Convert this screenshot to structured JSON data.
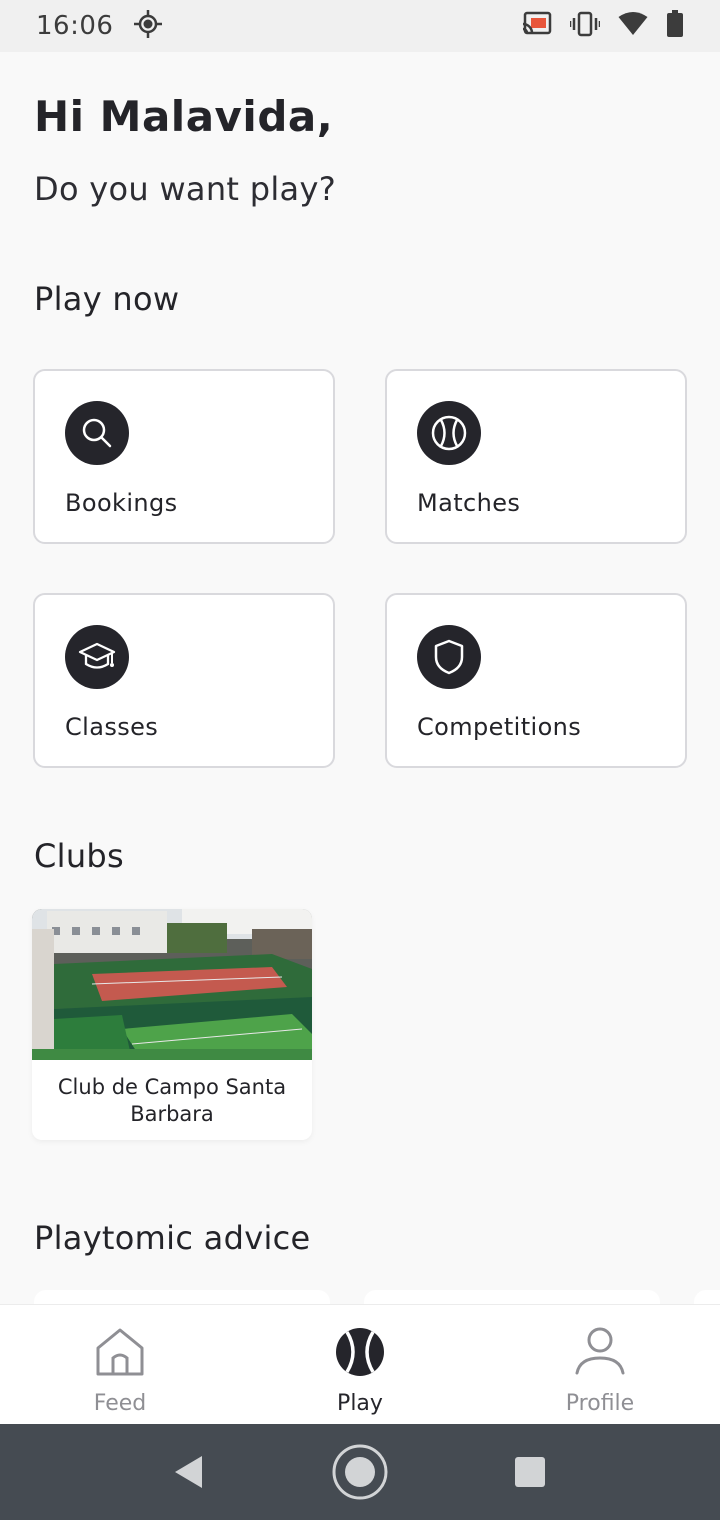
{
  "status_bar": {
    "time": "16:06"
  },
  "header": {
    "greeting": "Hi Malavida,",
    "subtitle": "Do you want play?"
  },
  "play_now": {
    "title": "Play now",
    "cards": [
      {
        "label": "Bookings",
        "icon": "search-icon"
      },
      {
        "label": "Matches",
        "icon": "ball-icon"
      },
      {
        "label": "Classes",
        "icon": "graduation-cap-icon"
      },
      {
        "label": "Competitions",
        "icon": "shield-icon"
      }
    ]
  },
  "clubs": {
    "title": "Clubs",
    "items": [
      {
        "name": "Club de Campo Santa Barbara"
      }
    ]
  },
  "advice": {
    "title": "Playtomic advice"
  },
  "bottom_nav": {
    "items": [
      {
        "label": "Feed",
        "icon": "home-icon",
        "active": false
      },
      {
        "label": "Play",
        "icon": "ball-icon",
        "active": true
      },
      {
        "label": "Profile",
        "icon": "person-icon",
        "active": false
      }
    ]
  },
  "colors": {
    "accent": "#25252b",
    "background": "#f9f9f9",
    "inactive": "#8f8f94",
    "system_nav": "#454b52"
  }
}
